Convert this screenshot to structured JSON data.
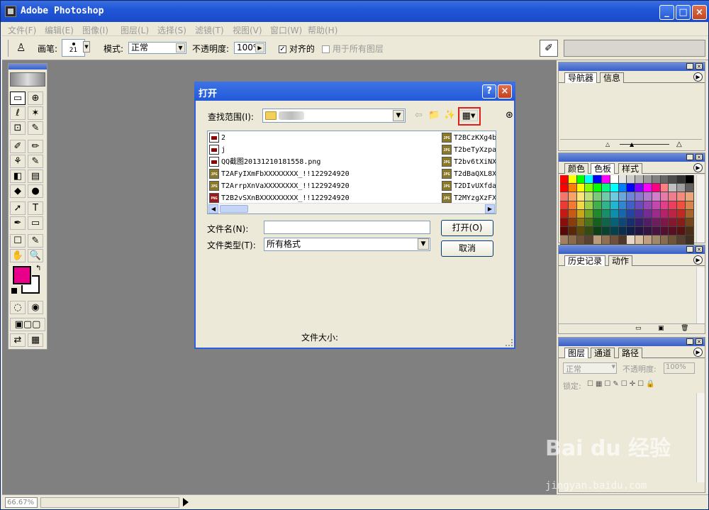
{
  "app": {
    "title": "Adobe Photoshop"
  },
  "window_controls": {
    "minimize": "_",
    "maximize": "□",
    "close": "×"
  },
  "menu": [
    "文件(F)",
    "编辑(E)",
    "图像(I)",
    "图层(L)",
    "选择(S)",
    "滤镜(T)",
    "视图(V)",
    "窗口(W)",
    "帮助(H)"
  ],
  "options": {
    "brush_label": "画笔:",
    "brush_size": "21",
    "mode_label": "模式:",
    "mode_value": "正常",
    "opacity_label": "不透明度:",
    "opacity_value": "100%",
    "aligned_label": "对齐的",
    "aligned_checked": "✓",
    "use_all_layers_label": "用于所有图层"
  },
  "toolbox": {
    "tools": [
      "▭",
      "⊕",
      "ℓ",
      "✶",
      "⊡",
      "✎",
      "✐",
      "✏",
      "⚘",
      "✎",
      "◧",
      "▤",
      "◆",
      "●",
      "➚",
      "T",
      "✒",
      "▭",
      "☐",
      "✎",
      "✋",
      "🔍"
    ]
  },
  "panels": {
    "navigator": {
      "tabs": [
        "导航器",
        "信息"
      ]
    },
    "color": {
      "tabs": [
        "颜色",
        "色板",
        "样式"
      ]
    },
    "history": {
      "tabs": [
        "历史记录",
        "动作"
      ]
    },
    "layers": {
      "tabs": [
        "图层",
        "通道",
        "路径"
      ],
      "blend_mode": "正常",
      "opacity_label": "不透明度:",
      "opacity_value": "100%",
      "lock_label": "锁定:"
    }
  },
  "swatches": [
    "#ff0000",
    "#ffff00",
    "#00ff00",
    "#00ffff",
    "#0000ff",
    "#ff00ff",
    "#ffffff",
    "#e6e6e6",
    "#cccccc",
    "#b3b3b3",
    "#999999",
    "#808080",
    "#666666",
    "#4d4d4d",
    "#333333",
    "#000000",
    "#ff0000",
    "#ff8000",
    "#ffff00",
    "#80ff00",
    "#00ff00",
    "#00ff80",
    "#00ffff",
    "#0080ff",
    "#0000ff",
    "#8000ff",
    "#ff00ff",
    "#ff0080",
    "#ff8080",
    "#c0c0c0",
    "#a0a0a0",
    "#606060",
    "#f4756c",
    "#f7a266",
    "#fbe57a",
    "#c1e07b",
    "#7dc97a",
    "#6fcba8",
    "#6ccbe0",
    "#6aa7df",
    "#6c85d6",
    "#8c77d0",
    "#b07bcf",
    "#d47ecb",
    "#e67aab",
    "#f07d8e",
    "#f58a7d",
    "#eba57a",
    "#ee3a33",
    "#f47a30",
    "#f5d84a",
    "#9dcf4b",
    "#3fb14a",
    "#2fb58b",
    "#1fb6d2",
    "#2e86d4",
    "#3f60c6",
    "#6a4bbd",
    "#9846b6",
    "#c645ae",
    "#e33e88",
    "#ec3e60",
    "#f0513f",
    "#d9844a",
    "#c41a12",
    "#c85a12",
    "#c9a818",
    "#74a523",
    "#1f8a2c",
    "#17906a",
    "#0b8faa",
    "#1568ad",
    "#23449f",
    "#4c2f98",
    "#752c92",
    "#9e2a8b",
    "#b5216a",
    "#be2245",
    "#c02a22",
    "#a8652a",
    "#8a0e0a",
    "#8a3c0b",
    "#8b7411",
    "#4f7318",
    "#14611e",
    "#0f644a",
    "#066277",
    "#0e4878",
    "#162f6e",
    "#351f69",
    "#511e66",
    "#6e1d60",
    "#7e1649",
    "#85172f",
    "#861d18",
    "#74461c",
    "#5a0806",
    "#5a2707",
    "#5c4c0b",
    "#344c10",
    "#0d4014",
    "#0a4231",
    "#03414f",
    "#092f50",
    "#0e1f49",
    "#231446",
    "#351444",
    "#481340",
    "#540f30",
    "#580f1f",
    "#581310",
    "#4d2e12",
    "#a08060",
    "#8a6a48",
    "#6e5238",
    "#5a4230",
    "#b89c7c",
    "#907050",
    "#70503a",
    "#503828",
    "#e8d8c8",
    "#d8c0a0",
    "#c0a080",
    "#a08868",
    "#886c50",
    "#705438",
    "#584030",
    "#403020"
  ],
  "dialog": {
    "title": "打开",
    "help_btn": "?",
    "close_btn": "×",
    "look_in_label": "查找范围(I):",
    "files_left": [
      {
        "name": "2",
        "type": "doc"
      },
      {
        "name": "j",
        "type": "doc"
      },
      {
        "name": "QQ截图20131210181558.png",
        "type": "doc"
      },
      {
        "name": "T2AFyIXmFbXXXXXXXX_!!122924920",
        "type": "jpg"
      },
      {
        "name": "T2ArrpXnVaXXXXXXXX_!!122924920",
        "type": "jpg"
      },
      {
        "name": "T2B2vSXnBXXXXXXXXX_!!122924920",
        "type": "png"
      }
    ],
    "files_right": [
      {
        "name": "T2BCzKXg4b",
        "type": "jpg"
      },
      {
        "name": "T2beTyXzpa",
        "type": "jpg"
      },
      {
        "name": "T2bv6tXiNX",
        "type": "jpg"
      },
      {
        "name": "T2dBaQXL8X",
        "type": "jpg"
      },
      {
        "name": "T2DIvUXfda",
        "type": "jpg"
      },
      {
        "name": "T2MYzgXzFX",
        "type": "jpg"
      }
    ],
    "filename_label": "文件名(N):",
    "filename_value": "",
    "filetype_label": "文件类型(T):",
    "filetype_value": "所有格式",
    "open_btn": "打开(O)",
    "cancel_btn": "取消",
    "filesize_label": "文件大小:"
  },
  "status": {
    "zoom": "66.67%"
  },
  "watermark": {
    "brand": "Bai du 经验",
    "url": "jingyan.baidu.com"
  }
}
